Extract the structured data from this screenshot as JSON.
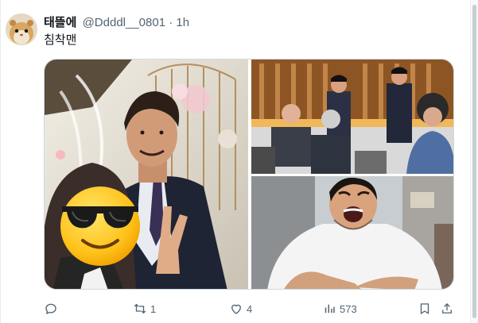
{
  "tweet": {
    "display_name": "태뜰에",
    "handle": "@Ddddl__0801",
    "separator": "·",
    "time": "1h",
    "text": "침착맨"
  },
  "actions": {
    "reply_count": "",
    "retweet_count": "1",
    "like_count": "4",
    "views_count": "573"
  },
  "icons": {
    "reply": "reply-icon",
    "retweet": "retweet-icon",
    "like": "heart-icon",
    "views": "views-icon",
    "share": "share-icon"
  },
  "colors": {
    "text_primary": "#0f1419",
    "text_secondary": "#536471",
    "border": "#cfd9de"
  }
}
